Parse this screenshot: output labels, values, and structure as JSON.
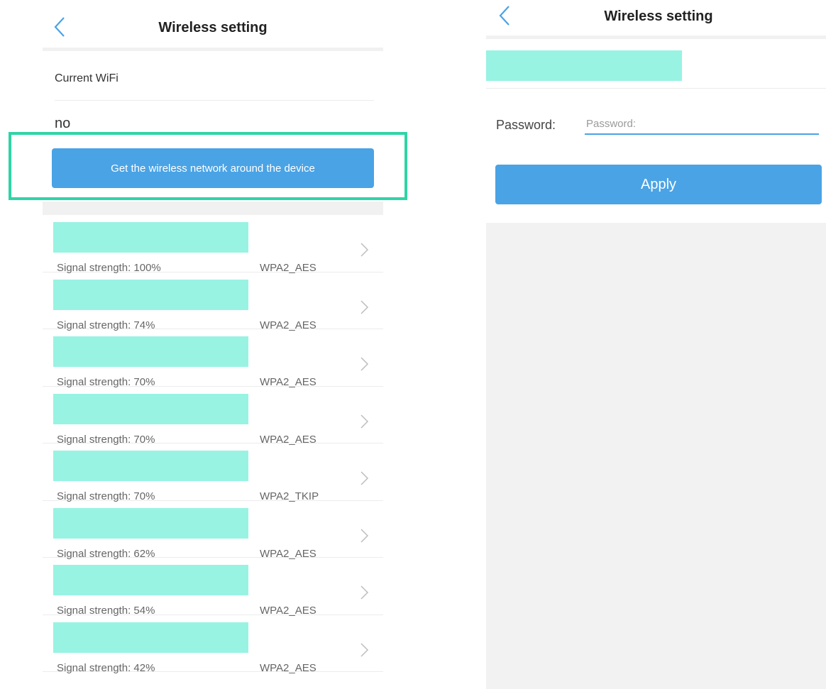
{
  "left": {
    "title": "Wireless setting",
    "current_wifi_label": "Current WiFi",
    "current_wifi_value": "no",
    "scan_button_label": "Get the wireless network around the device",
    "networks": [
      {
        "signal": "Signal strength: 100%",
        "security": "WPA2_AES"
      },
      {
        "signal": "Signal strength: 74%",
        "security": "WPA2_AES"
      },
      {
        "signal": "Signal strength: 70%",
        "security": "WPA2_AES"
      },
      {
        "signal": "Signal strength: 70%",
        "security": "WPA2_AES"
      },
      {
        "signal": "Signal strength: 70%",
        "security": "WPA2_TKIP"
      },
      {
        "signal": "Signal strength: 62%",
        "security": "WPA2_AES"
      },
      {
        "signal": "Signal strength: 54%",
        "security": "WPA2_AES"
      },
      {
        "signal": "Signal strength: 42%",
        "security": "WPA2_AES"
      }
    ]
  },
  "right": {
    "title": "Wireless setting",
    "password_label": "Password:",
    "password_placeholder": "Password:",
    "password_value": "",
    "apply_button_label": "Apply"
  },
  "icons": {
    "back": "back-arrow-icon",
    "row_chevron": "chevron-right-icon"
  },
  "colors": {
    "accent": "#4aa3e5",
    "redaction": "#98f3e3",
    "highlight_frame": "#2fd4a6",
    "separator": "#f1f1f1"
  }
}
